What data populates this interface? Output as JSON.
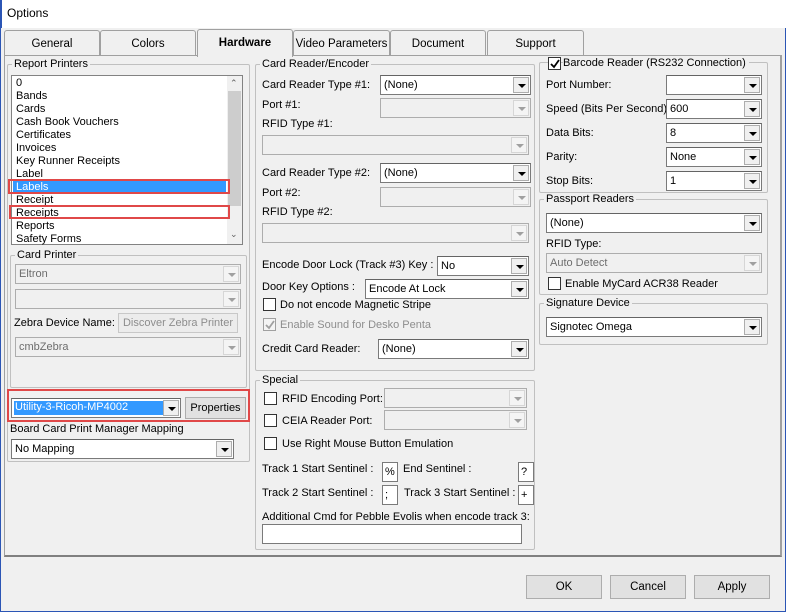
{
  "window": {
    "title": "Options"
  },
  "tabs": [
    {
      "label": "General",
      "active": false
    },
    {
      "label": "Colors",
      "active": false
    },
    {
      "label": "Hardware",
      "active": true
    },
    {
      "label": "Video Parameters",
      "active": false
    },
    {
      "label": "Document Scanner",
      "active": false
    },
    {
      "label": "Support",
      "active": false
    }
  ],
  "report_printers": {
    "legend": "Report Printers",
    "items": [
      "0",
      "Bands",
      "Cards",
      "Cash Book Vouchers",
      "Certificates",
      "Invoices",
      "Key Runner Receipts",
      "Label",
      "Labels",
      "Receipt",
      "Receipts",
      "Reports",
      "Safety Forms"
    ],
    "selected": "Labels",
    "highlighted": [
      "Labels",
      "Receipts"
    ]
  },
  "card_printer": {
    "legend": "Card Printer",
    "printer_value": "Eltron",
    "second_value": "",
    "zebra_label": "Zebra Device Name:",
    "discover_button": "Discover Zebra Printer",
    "zebra_value": "cmbZebra"
  },
  "printer_select": {
    "value": "Utility-3-Ricoh-MP4002",
    "properties_button": "Properties"
  },
  "board_mapping": {
    "label": "Board Card Print Manager Mapping",
    "value": "No Mapping"
  },
  "card_reader": {
    "legend": "Card Reader/Encoder",
    "type1_label": "Card Reader Type #1:",
    "type1_value": "(None)",
    "port1_label": "Port #1:",
    "port1_value": "",
    "rfid1_label": "RFID Type #1:",
    "rfid1_value": "",
    "type2_label": "Card Reader Type #2:",
    "type2_value": "(None)",
    "port2_label": "Port #2:",
    "port2_value": "",
    "rfid2_label": "RFID Type #2:",
    "rfid2_value": "",
    "door_lock_label": "Encode Door Lock (Track #3) Key :",
    "door_lock_value": "No",
    "door_key_label": "Door Key Options :",
    "door_key_value": "Encode At Lock",
    "no_mag_label": "Do not encode Magnetic Stripe",
    "no_mag_checked": false,
    "desko_label": "Enable Sound for Desko Penta",
    "desko_checked": true,
    "credit_label": "Credit Card Reader:",
    "credit_value": "(None)"
  },
  "special": {
    "legend": "Special",
    "rfid_port_label": "RFID Encoding Port:",
    "rfid_port_checked": false,
    "rfid_port_value": "",
    "ceia_label": "CEIA Reader Port:",
    "ceia_checked": false,
    "ceia_value": "",
    "right_mouse_label": "Use Right Mouse Button Emulation",
    "right_mouse_checked": false,
    "track1_label": "Track 1 Start Sentinel :",
    "track1_value": "%",
    "end_label": "End Sentinel :",
    "end_value": "?",
    "track2_label": "Track 2 Start Sentinel :",
    "track2_value": ";",
    "track3_label": "Track 3 Start Sentinel :",
    "track3_value": "+",
    "pebble_label": "Additional Cmd for Pebble Evolis when encode track 3:",
    "pebble_value": ""
  },
  "barcode": {
    "legend": "Barcode Reader (RS232 Connection)",
    "enabled": true,
    "port_label": "Port Number:",
    "port_value": "",
    "speed_label": "Speed (Bits Per Second):",
    "speed_value": "600",
    "databits_label": "Data Bits:",
    "databits_value": "8",
    "parity_label": "Parity:",
    "parity_value": "None",
    "stopbits_label": "Stop Bits:",
    "stopbits_value": "1"
  },
  "passport": {
    "legend": "Passport Readers",
    "value": "(None)",
    "rfid_label": "RFID Type:",
    "rfid_value": "Auto Detect",
    "mycard_label": "Enable MyCard ACR38 Reader",
    "mycard_checked": false
  },
  "signature": {
    "legend": "Signature Device",
    "value": "Signotec Omega"
  },
  "buttons": {
    "ok": "OK",
    "cancel": "Cancel",
    "apply": "Apply"
  },
  "colors": {
    "selection": "#3399ff",
    "highlight_box": "#e04848",
    "window_border": "#2b55b5"
  }
}
